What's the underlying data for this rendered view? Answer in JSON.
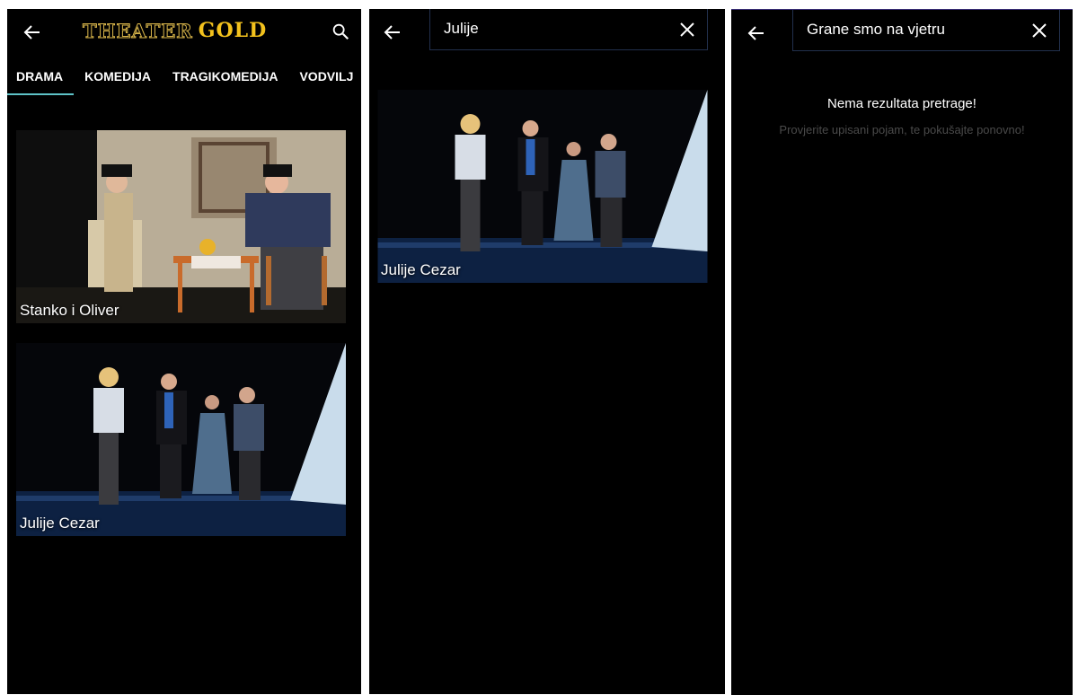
{
  "screen1": {
    "logo_word1": "THEATER",
    "logo_word2": "GOLD",
    "tabs": [
      "DRAMA",
      "KOMEDIJA",
      "TRAGIKOMEDIJA",
      "VODVILJ"
    ],
    "active_tab": "DRAMA",
    "shows": [
      {
        "title": "Stanko i Oliver"
      },
      {
        "title": "Julije Cezar"
      }
    ]
  },
  "screen2": {
    "search_value": "Julije",
    "results": [
      {
        "title": "Julije Cezar"
      }
    ]
  },
  "screen3": {
    "search_value": "Grane smo na vjetru",
    "no_results_title": "Nema rezultata pretrage!",
    "no_results_hint": "Provjerite upisani pojam, te pokušajte ponovno!"
  },
  "icons": [
    "back-arrow-icon",
    "search-icon",
    "close-icon"
  ],
  "colors": {
    "background": "#000000",
    "tab_indicator": "#5ec2c7",
    "logo_gold": "#f3c21d"
  }
}
